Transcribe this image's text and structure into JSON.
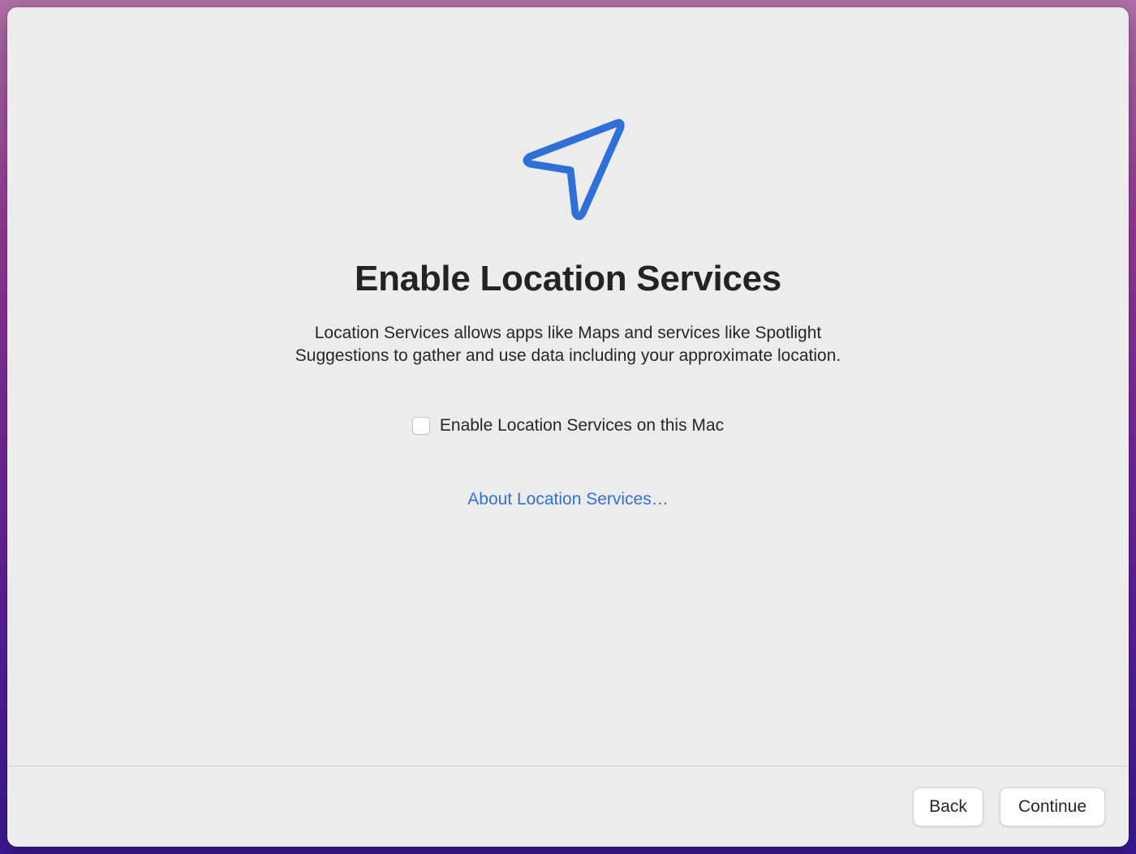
{
  "page": {
    "title": "Enable Location Services",
    "description_lines": [
      "Location Services allows apps like Maps and services like Spotlight",
      "Suggestions to gather and use data including your approximate location."
    ]
  },
  "icon": {
    "name": "location-arrow-icon",
    "color": "#2f6fd8"
  },
  "checkbox": {
    "label": "Enable Location Services on this Mac",
    "checked": false
  },
  "link": {
    "label": "About Location Services…",
    "color": "#2f6fd8"
  },
  "footer": {
    "back_label": "Back",
    "continue_label": "Continue"
  }
}
